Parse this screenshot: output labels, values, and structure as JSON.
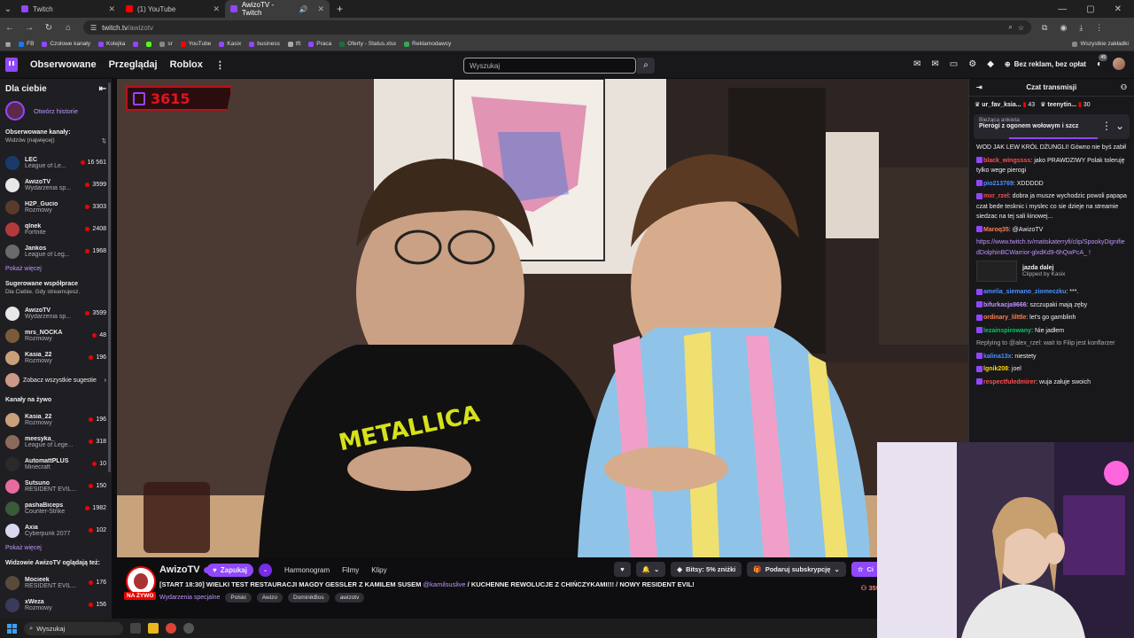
{
  "browser": {
    "tabs": [
      {
        "title": "Twitch",
        "active": false
      },
      {
        "title": "(1) YouTube",
        "active": false
      },
      {
        "title": "AwizoTV - Twitch",
        "active": true
      }
    ],
    "url_host": "twitch.tv",
    "url_path": "/awizotv",
    "bookmarks": [
      "FB",
      "Czołowe kanały",
      "Kolejka",
      "sr",
      "YouTube",
      "Kasix",
      "business",
      "tft",
      "Praca",
      "Oferty - Status.xlsx",
      "Reklamodawcy"
    ],
    "bookmarks_right": "Wszystkie zakładki"
  },
  "nav": {
    "following": "Obserwowane",
    "browse": "Przeglądaj",
    "roblox": "Roblox",
    "search_placeholder": "Wyszukaj",
    "adfree": "Bez reklam, bez opłat",
    "notif_count": "49"
  },
  "sidebar": {
    "title": "Dla ciebie",
    "history": "Otwórz historie",
    "followed_title": "Obserwowane kanały:",
    "followed_sort": "Widzów (najwięcej)",
    "followed": [
      {
        "name": "LEC",
        "game": "League of Le...",
        "viewers": "16 561",
        "color": "#1a3a6a"
      },
      {
        "name": "AwizoTV",
        "game": "Wydarzenia sp...",
        "viewers": "3599",
        "color": "#e8e8e8"
      },
      {
        "name": "H2P_Gucio",
        "game": "Rozmowy",
        "viewers": "3303",
        "color": "#5a3a2a"
      },
      {
        "name": "qlnek",
        "game": "Fortnite",
        "viewers": "2408",
        "color": "#b33a3a"
      },
      {
        "name": "Jankos",
        "game": "League of Leg...",
        "viewers": "1968",
        "color": "#6a6a6a"
      }
    ],
    "show_more": "Pokaż więcej",
    "recommended_title": "Sugerowane współprace",
    "recommended_sub": "Dla Ciebie. Gdy streamujesz.",
    "recommended": [
      {
        "name": "AwizoTV",
        "game": "Wydarzenia sp...",
        "viewers": "3599",
        "color": "#e8e8e8"
      },
      {
        "name": "mrs_NOCKA",
        "game": "Rozmowy",
        "viewers": "48",
        "color": "#7a5a3a"
      },
      {
        "name": "Kasia_22",
        "game": "Rozmowy",
        "viewers": "196",
        "color": "#caa07a"
      }
    ],
    "see_all": "Zobacz wszystkie sugestie",
    "live_title": "Kanały na żywo",
    "live": [
      {
        "name": "Kasia_22",
        "game": "Rozmowy",
        "viewers": "196",
        "color": "#caa07a"
      },
      {
        "name": "meesyka_",
        "game": "League of Lege...",
        "viewers": "318",
        "color": "#8a6a5a"
      },
      {
        "name": "AutomattPLUS",
        "game": "Minecraft",
        "viewers": "10",
        "color": "#2a2a2a"
      },
      {
        "name": "Sutsuno",
        "game": "RESIDENT EVIL...",
        "viewers": "150",
        "color": "#e86aa0"
      },
      {
        "name": "pashaBiceps",
        "game": "Counter-Strike",
        "viewers": "1982",
        "color": "#3a5a3a"
      },
      {
        "name": "Axia",
        "game": "Cyberpunk 2077",
        "viewers": "102",
        "color": "#d8d8f0"
      }
    ],
    "show_more2": "Pokaż więcej",
    "watching_title": "Widzowie AwizoTV oglądają też:",
    "watching": [
      {
        "name": "Mocieek",
        "game": "RESIDENT EVIL...",
        "viewers": "176",
        "color": "#5a4a3a"
      },
      {
        "name": "xWeza",
        "game": "Rozmowy",
        "viewers": "156",
        "color": "#3a3a5a"
      }
    ]
  },
  "video": {
    "counter": "3615"
  },
  "channel": {
    "name": "AwizoTV",
    "follow": "Zapukaj",
    "live": "NA ŻYWO",
    "tabs": [
      "Harmonogram",
      "Filmy",
      "Klipy"
    ],
    "title_main": "[START 18:30] WIELKI TEST RESTAURACJI MAGDY GESSLER Z KAMILEM SUSEM",
    "title_mention": "@kamilsuslive",
    "title_rest": "/ KUCHENNE REWOLUCJE Z CHIŃCZYKAMI!!! / NOWY RESIDENT EVIL!",
    "category": "Wydarzenia specjalne",
    "tags": [
      "Polski",
      "Awizo",
      "DominikBos",
      "awizotv"
    ],
    "bits": "Bitsy: 5% zniżki",
    "gift": "Podaruj subskrypcję",
    "sub": "Ci",
    "viewers": "359"
  },
  "chat": {
    "title": "Czat transmisji",
    "leaders": [
      {
        "name": "ur_fav_ksia...",
        "gift": "43"
      },
      {
        "name": "teenytin...",
        "gift": "30"
      }
    ],
    "poll_label": "Bieżąca ankieta",
    "poll_question": "Pierogi z ogonem wołowym i szcz",
    "messages": [
      {
        "user": "",
        "color": "#efeff1",
        "text": "WOD JAK LEW KRÓL DŻUNGLI! Gówno nie byś zabił"
      },
      {
        "user": "black_wingssss",
        "color": "#ff4d4d",
        "text": ": jako PRAWDZIWY Polak toleruję tylko wege pierogi"
      },
      {
        "user": "pio213769",
        "color": "#4d90ff",
        "text": ": XDDDDD"
      },
      {
        "user": "mxr_rzel",
        "color": "#ff4d4d",
        "text": ": dobra ja musze wychodzic powoli papapa czat bede tesknic i myslec co sie dzieje na streamie siedzac na tej sali kinowej..."
      },
      {
        "user": "Maroq35",
        "color": "#ff7f50",
        "text": ": @AwizoTV"
      },
      {
        "user": "",
        "color": "#bf94ff",
        "text": "https://www.twitch.tv/matiskaterryfi/clip/SpookyDignifiedDolphinBCWarrior-glxdKd9-6hQwPcA_ !"
      },
      {
        "user": "amelia_siemano_ziomeczku",
        "color": "#4d90ff",
        "text": ": ***."
      },
      {
        "user": "bifurkacja9666",
        "color": "#bf94ff",
        "text": ": szczupaki mają zęby"
      },
      {
        "user": "ordinary_lilttle",
        "color": "#ff7f50",
        "text": ": let's go gamblinh"
      },
      {
        "user": "lezainspirowany",
        "color": "#00c864",
        "text": ": Nie jadłem"
      },
      {
        "user": "",
        "color": "#adadb8",
        "text": "Replying to @alex_rzel: wait to Filip jest konflarzer"
      },
      {
        "user": "kalina13x",
        "color": "#4d90ff",
        "text": ": niestety"
      },
      {
        "user": "lgnik208",
        "color": "#ffd700",
        "text": ": joel"
      },
      {
        "user": "respectfuledmirer",
        "color": "#ff4d4d",
        "text": ": wuja załuje swoich"
      }
    ],
    "clip_title": "jazda dalej",
    "clip_sub": "Clipped by Kasix"
  },
  "taskbar": {
    "search": "Wyszukaj"
  }
}
